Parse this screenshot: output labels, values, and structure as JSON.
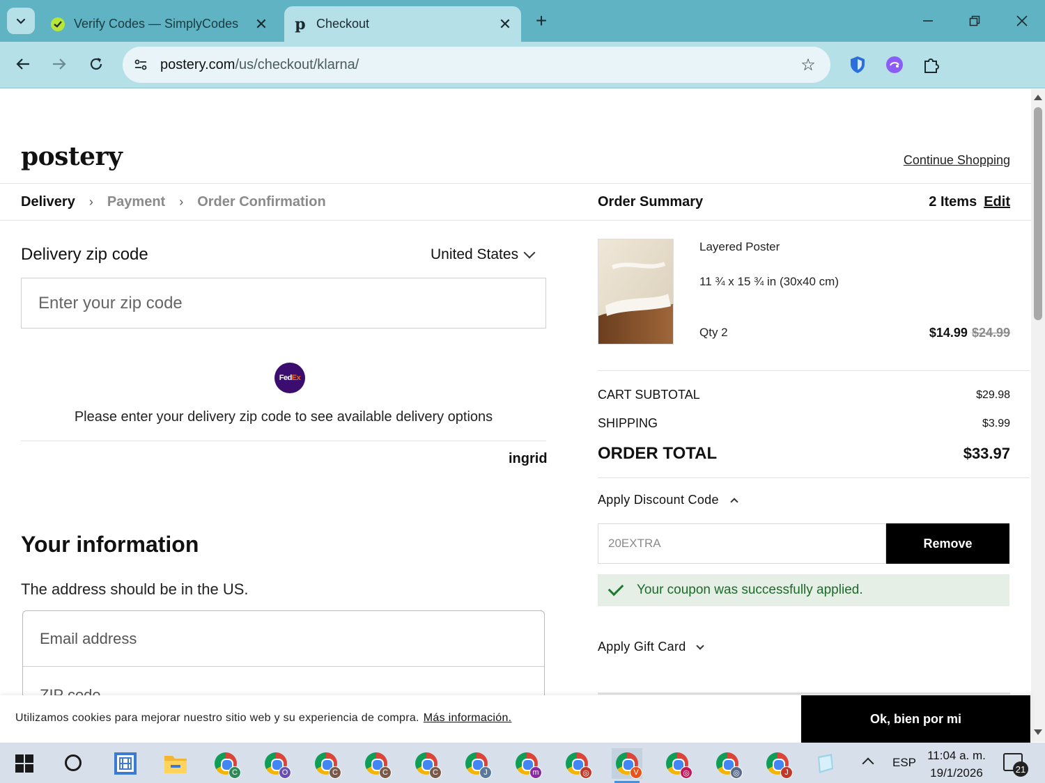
{
  "browser": {
    "tabs": [
      {
        "title": "Verify Codes — SimplyCodes",
        "active": false,
        "favicon": "simplycodes-icon"
      },
      {
        "title": "Checkout",
        "active": true,
        "favicon": "postery-p-icon"
      }
    ],
    "new_tab": "+",
    "url_host": "postery.com",
    "url_path": "/us/checkout/klarna/",
    "profile_initial": "V",
    "colors": {
      "tabstrip": "#5fb3c3",
      "toolbar": "#b6e0e8",
      "profile": "#e8541c"
    }
  },
  "page": {
    "logo": "postery",
    "continue_shopping": "Continue Shopping",
    "breadcrumbs": [
      {
        "label": "Delivery",
        "current": true
      },
      {
        "label": "Payment",
        "current": false
      },
      {
        "label": "Order Confirmation",
        "current": false
      }
    ],
    "delivery": {
      "zip_label": "Delivery zip code",
      "country": "United States",
      "zip_placeholder": "Enter your zip code",
      "carrier_fed": "Fed",
      "carrier_ex": "Ex",
      "message": "Please enter your delivery zip code to see available delivery options",
      "provider": "ingrid"
    },
    "info": {
      "title": "Your information",
      "subtitle": "The address should be in the US.",
      "email_placeholder": "Email address",
      "zip_placeholder": "ZIP code"
    }
  },
  "summary": {
    "title": "Order Summary",
    "items_count": "2 Items",
    "edit": "Edit",
    "product": {
      "name": "Layered Poster",
      "size": "11 ¾ x 15 ¾ in (30x40 cm)",
      "qty": "Qty 2",
      "price": "$14.99",
      "old_price": "$24.99"
    },
    "subtotal_label": "CART SUBTOTAL",
    "subtotal_value": "$29.98",
    "shipping_label": "SHIPPING",
    "shipping_value": "$3.99",
    "total_label": "ORDER TOTAL",
    "total_value": "$33.97",
    "discount_toggle": "Apply Discount Code",
    "discount_code": "20EXTRA",
    "remove_button": "Remove",
    "success_message": "Your coupon was successfully applied.",
    "gift_toggle": "Apply Gift Card"
  },
  "cookie": {
    "text": "Utilizamos cookies para mejorar nuestro sitio web y su experiencia de compra.",
    "more": "Más información.",
    "ok": "Ok, bien por mi"
  },
  "taskbar": {
    "items": [
      {
        "name": "task-view-icon"
      },
      {
        "name": "file-explorer-icon"
      },
      {
        "name": "chrome-profile-c-icon",
        "badge": "C",
        "badge_color": "#2e8b57"
      },
      {
        "name": "chrome-profile-o-icon",
        "badge": "O",
        "badge_color": "#6a4fb3"
      },
      {
        "name": "chrome-profile-c2-icon",
        "badge": "C",
        "badge_color": "#7a5a4a"
      },
      {
        "name": "chrome-profile-c3-icon",
        "badge": "C",
        "badge_color": "#7a5a4a"
      },
      {
        "name": "chrome-profile-c4-icon",
        "badge": "C",
        "badge_color": "#7a5a4a"
      },
      {
        "name": "chrome-profile-j-icon",
        "badge": "J",
        "badge_color": "#5a7a9a"
      },
      {
        "name": "chrome-profile-m-icon",
        "badge": "m",
        "badge_color": "#8a2aa0"
      },
      {
        "name": "chrome-profile-a-icon",
        "badge": "◎",
        "badge_color": "#c0392b"
      },
      {
        "name": "chrome-profile-v-icon",
        "badge": "V",
        "badge_color": "#e8541c"
      },
      {
        "name": "chrome-profile-b-icon",
        "badge": "◎",
        "badge_color": "#c2185b"
      },
      {
        "name": "chrome-profile-d-icon",
        "badge": "◎",
        "badge_color": "#5a6a8a"
      },
      {
        "name": "chrome-profile-j2-icon",
        "badge": "J",
        "badge_color": "#c0392b"
      },
      {
        "name": "notes-app-icon"
      }
    ],
    "language": "ESP",
    "time": "11:04 a. m.",
    "date": "19/1/2026",
    "notifications": "21"
  }
}
